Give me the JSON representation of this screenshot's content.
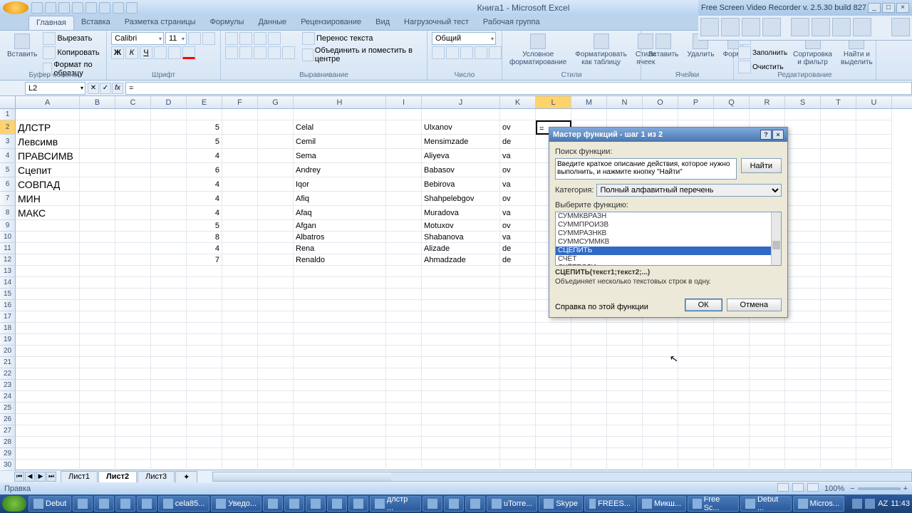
{
  "title": "Книга1 - Microsoft Excel",
  "recorder_title": "Free Screen Video Recorder v. 2.5.30 build 827",
  "ribbon_tabs": [
    "Главная",
    "Вставка",
    "Разметка страницы",
    "Формулы",
    "Данные",
    "Рецензирование",
    "Вид",
    "Нагрузочный тест",
    "Рабочая группа"
  ],
  "active_tab": 0,
  "ribbon": {
    "clipboard": {
      "paste": "Вставить",
      "cut": "Вырезать",
      "copy": "Копировать",
      "format": "Формат по образцу",
      "label": "Буфер обмена"
    },
    "font": {
      "name": "Calibri",
      "size": "11",
      "label": "Шрифт"
    },
    "align": {
      "wrap": "Перенос текста",
      "merge": "Объединить и поместить в центре",
      "label": "Выравнивание"
    },
    "number": {
      "format": "Общий",
      "label": "Число"
    },
    "styles": {
      "cond": "Условное форматирование",
      "table": "Форматировать как таблицу",
      "cell": "Стили ячеек",
      "label": "Стили"
    },
    "cells": {
      "insert": "Вставить",
      "delete": "Удалить",
      "format": "Формат",
      "label": "Ячейки"
    },
    "editing": {
      "fill": "Заполнить",
      "clear": "Очистить",
      "sort": "Сортировка и фильтр",
      "find": "Найти и выделить",
      "label": "Редактирование"
    }
  },
  "name_box": "L2",
  "formula": "=",
  "columns": [
    "A",
    "B",
    "C",
    "D",
    "E",
    "F",
    "G",
    "H",
    "I",
    "J",
    "K",
    "L",
    "M",
    "N",
    "O",
    "P",
    "Q",
    "R",
    "S",
    "T",
    "U"
  ],
  "active_col_index": 11,
  "active_row": 2,
  "active_cell_value": "=",
  "data_rows": [
    {
      "a": "ДЛСТР",
      "e": "5",
      "h": "Celal",
      "j": "Ulxanov",
      "k": "ov"
    },
    {
      "a": "Левсимв",
      "e": "5",
      "h": "Cemil",
      "j": "Mensimzade",
      "k": "de"
    },
    {
      "a": "ПРАВСИМВ",
      "e": "4",
      "h": "Sema",
      "j": "Aliyeva",
      "k": "va"
    },
    {
      "a": "Сцепит",
      "e": "6",
      "h": "Andrey",
      "j": "Babasov",
      "k": "ov"
    },
    {
      "a": "СОВПАД",
      "e": "4",
      "h": "Iqor",
      "j": "Bebirova",
      "k": "va"
    },
    {
      "a": "МИН",
      "e": "4",
      "h": "Afiq",
      "j": "Shahpelebgov",
      "k": "ov"
    },
    {
      "a": "МАКС",
      "e": "4",
      "h": "Afaq",
      "j": "Muradova",
      "k": "va"
    },
    {
      "a": "",
      "e": "5",
      "h": "Afgan",
      "j": "Motuxov",
      "k": "ov"
    },
    {
      "a": "",
      "e": "8",
      "h": "Albatros",
      "j": "Shabanova",
      "k": "va"
    },
    {
      "a": "",
      "e": "4",
      "h": "Rena",
      "j": "Alizade",
      "k": "de"
    },
    {
      "a": "",
      "e": "7",
      "h": "Renaldo",
      "j": "Ahmadzade",
      "k": "de"
    }
  ],
  "sheets": [
    "Лист1",
    "Лист2",
    "Лист3"
  ],
  "active_sheet": 1,
  "status": "Правка",
  "zoom": "100%",
  "dialog": {
    "title": "Мастер функций - шаг 1 из 2",
    "search_label": "Поиск функции:",
    "search_text": "Введите краткое описание действия, которое нужно выполнить, и нажмите кнопку \"Найти\"",
    "find_btn": "Найти",
    "category_label": "Категория:",
    "category_value": "Полный алфавитный перечень",
    "select_label": "Выберите функцию:",
    "functions": [
      "СУММКВРАЗН",
      "СУММПРОИЗВ",
      "СУММРАЗНКВ",
      "СУММСУММКВ",
      "СЦЕПИТЬ",
      "СЧЁТ",
      "СЧЁТЕСЛИ"
    ],
    "selected_index": 4,
    "signature": "СЦЕПИТЬ(текст1;текст2;...)",
    "description": "Объединяет несколько текстовых строк в одну.",
    "help_link": "Справка по этой функции",
    "ok": "ОК",
    "cancel": "Отмена"
  },
  "taskbar": {
    "items": [
      "Debut",
      "",
      "",
      "",
      "",
      "cela85...",
      "Уведо...",
      "",
      "",
      "",
      "",
      "",
      "длстр ...",
      "",
      "",
      "",
      "uTorre...",
      "Skype",
      "FREES...",
      "Микш...",
      "Free Sc...",
      "Debut ...",
      "Micros..."
    ],
    "lang": "AZ",
    "time": "11:43"
  }
}
